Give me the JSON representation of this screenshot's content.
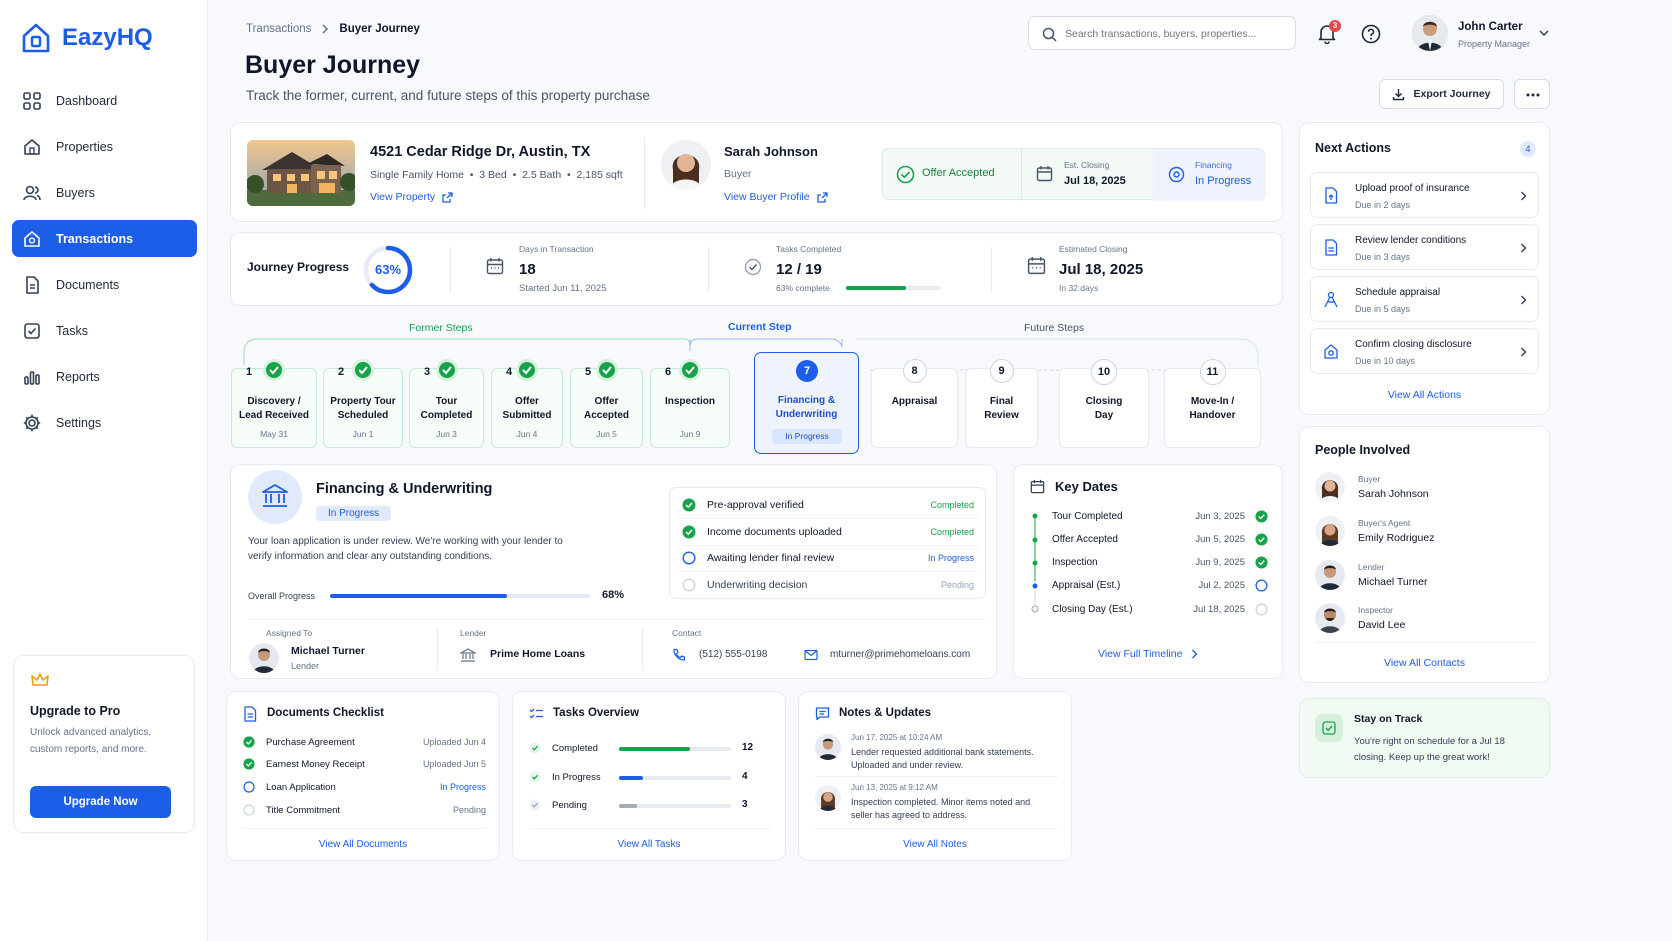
{
  "app": {
    "name": "EazyHQ"
  },
  "sidebar": {
    "items": [
      {
        "label": "Dashboard"
      },
      {
        "label": "Properties"
      },
      {
        "label": "Buyers"
      },
      {
        "label": "Transactions"
      },
      {
        "label": "Documents"
      },
      {
        "label": "Tasks"
      },
      {
        "label": "Reports"
      },
      {
        "label": "Settings"
      }
    ],
    "upgrade": {
      "title": "Upgrade to Pro",
      "desc1": "Unlock advanced analytics,",
      "desc2": "custom reports, and more.",
      "button": "Upgrade Now"
    }
  },
  "breadcrumb": {
    "parent": "Transactions",
    "current": "Buyer Journey"
  },
  "page": {
    "title": "Buyer Journey",
    "subtitle": "Track the former, current, and future steps of this property purchase"
  },
  "search": {
    "placeholder": "Search transactions, buyers, properties..."
  },
  "notifications": {
    "count": "3"
  },
  "user": {
    "name": "John Carter",
    "role": "Property Manager"
  },
  "actions": {
    "export": "Export Journey"
  },
  "property": {
    "address": "4521 Cedar Ridge Dr, Austin, TX",
    "details": "Single Family Home  •  3 Bed  •  2.5 Bath  •  2,185 sqft",
    "link": "View Property"
  },
  "buyer": {
    "name": "Sarah Johnson",
    "role": "Buyer",
    "link": "View Buyer Profile"
  },
  "status": {
    "offer": "Offer Accepted",
    "closing_label": "Est. Closing",
    "closing_value": "Jul 18, 2025",
    "financing_label": "Financing",
    "financing_value": "In Progress"
  },
  "progress": {
    "label": "Journey Progress",
    "percent": "63%",
    "percent_value": 63,
    "days_label": "Days in Transaction",
    "days_value": "18",
    "days_sub": "Started Jun 11, 2025",
    "tasks_label": "Tasks Completed",
    "tasks_value": "12 / 19",
    "tasks_sub": "63% complete",
    "tasks_fraction": 0.63,
    "est_label": "Estimated Closing",
    "est_value": "Jul 18, 2025",
    "est_sub": "In 32 days"
  },
  "steps_headers": {
    "former": "Former Steps",
    "current": "Current Step",
    "future": "Future Steps"
  },
  "steps": {
    "former": [
      {
        "num": "1",
        "l1": "Discovery /",
        "l2": "Lead Received",
        "date": "May 31"
      },
      {
        "num": "2",
        "l1": "Property Tour",
        "l2": "Scheduled",
        "date": "Jun 1"
      },
      {
        "num": "3",
        "l1": "Tour",
        "l2": "Completed",
        "date": "Jun 3"
      },
      {
        "num": "4",
        "l1": "Offer",
        "l2": "Submitted",
        "date": "Jun 4"
      },
      {
        "num": "5",
        "l1": "Offer",
        "l2": "Accepted",
        "date": "Jun 5"
      },
      {
        "num": "6",
        "l1": "Inspection",
        "l2": "",
        "date": "Jun 9"
      }
    ],
    "current": {
      "num": "7",
      "l1": "Financing &",
      "l2": "Underwriting",
      "status": "In Progress"
    },
    "future": [
      {
        "num": "8",
        "l1": "Appraisal",
        "l2": ""
      },
      {
        "num": "9",
        "l1": "Final",
        "l2": "Review"
      },
      {
        "num": "10",
        "l1": "Closing",
        "l2": "Day"
      },
      {
        "num": "11",
        "l1": "Move-In /",
        "l2": "Handover"
      }
    ]
  },
  "financing": {
    "title": "Financing & Underwriting",
    "status": "In Progress",
    "desc1": "Your loan application is under review. We're working with your lender to",
    "desc2": "verify information and clear any outstanding conditions.",
    "overall_label": "Overall Progress",
    "overall_percent": "68%",
    "overall_value": 68,
    "checklist": [
      {
        "label": "Pre-approval verified",
        "status": "Completed"
      },
      {
        "label": "Income documents uploaded",
        "status": "Completed"
      },
      {
        "label": "Awaiting lender final review",
        "status": "In Progress"
      },
      {
        "label": "Underwriting decision",
        "status": "Pending"
      }
    ],
    "assigned_label": "Assigned To",
    "assigned_name": "Michael Turner",
    "assigned_role": "Lender",
    "lender_label": "Lender",
    "lender_name": "Prime Home Loans",
    "contact_label": "Contact",
    "phone": "(512) 555-0198",
    "email": "mturner@primehomeloans.com"
  },
  "key_dates": {
    "title": "Key Dates",
    "items": [
      {
        "label": "Tour Completed",
        "date": "Jun 3, 2025"
      },
      {
        "label": "Offer Accepted",
        "date": "Jun 5, 2025"
      },
      {
        "label": "Inspection",
        "date": "Jun 9, 2025"
      },
      {
        "label": "Appraisal (Est.)",
        "date": "Jul 2, 2025"
      },
      {
        "label": "Closing Day (Est.)",
        "date": "Jul 18, 2025"
      }
    ],
    "link": "View Full Timeline"
  },
  "next_actions": {
    "title": "Next Actions",
    "count": "4",
    "items": [
      {
        "title": "Upload proof of insurance",
        "due": "Due in 2 days"
      },
      {
        "title": "Review lender conditions",
        "due": "Due in 3 days"
      },
      {
        "title": "Schedule appraisal",
        "due": "Due in 5 days"
      },
      {
        "title": "Confirm closing disclosure",
        "due": "Due in 10 days"
      }
    ],
    "link": "View All Actions"
  },
  "people": {
    "title": "People Involved",
    "items": [
      {
        "role": "Buyer",
        "name": "Sarah Johnson"
      },
      {
        "role": "Buyer's Agent",
        "name": "Emily Rodriguez"
      },
      {
        "role": "Lender",
        "name": "Michael Turner"
      },
      {
        "role": "Inspector",
        "name": "David Lee"
      }
    ],
    "link": "View All Contacts"
  },
  "stay": {
    "title": "Stay on Track",
    "desc1": "You're right on schedule for a Jul 18",
    "desc2": "closing. Keep up the great work!"
  },
  "documents": {
    "title": "Documents Checklist",
    "items": [
      {
        "name": "Purchase Agreement",
        "status": "Uploaded Jun 4"
      },
      {
        "name": "Earnest Money Receipt",
        "status": "Uploaded Jun 5"
      },
      {
        "name": "Loan Application",
        "status": "In Progress"
      },
      {
        "name": "Title Commitment",
        "status": "Pending"
      }
    ],
    "link": "View All Documents"
  },
  "tasks": {
    "title": "Tasks Overview",
    "items": [
      {
        "label": "Completed",
        "count": "12",
        "fraction": 0.63
      },
      {
        "label": "In Progress",
        "count": "4",
        "fraction": 0.21
      },
      {
        "label": "Pending",
        "count": "3",
        "fraction": 0.16
      }
    ],
    "link": "View All Tasks"
  },
  "notes": {
    "title": "Notes & Updates",
    "items": [
      {
        "time": "Jun 17, 2025 at 10:24 AM",
        "l1": "Lender requested additional bank statements.",
        "l2": "Uploaded and under review."
      },
      {
        "time": "Jun 13, 2025 at 9:12 AM",
        "l1": "Inspection completed. Minor items noted and",
        "l2": "seller has agreed to address."
      }
    ],
    "link": "View All Notes"
  },
  "colors": {
    "primary": "#1d5ee8",
    "success": "#16a34a"
  }
}
